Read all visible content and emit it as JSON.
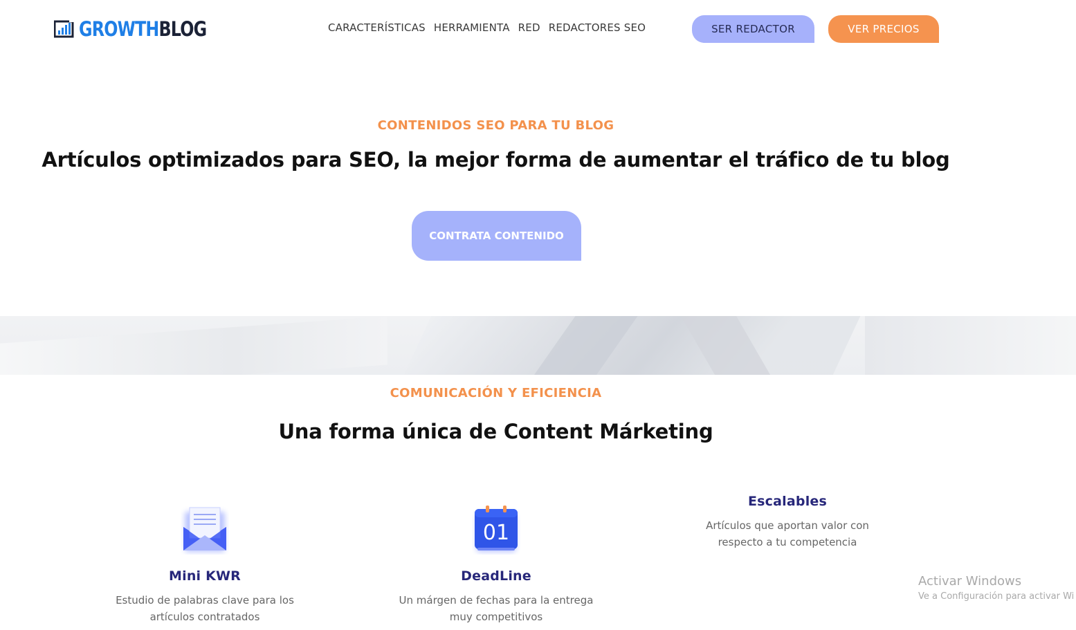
{
  "header": {
    "logo": {
      "part1": "GROWTH",
      "part2": "BLOG"
    },
    "nav": [
      {
        "label": "CARACTERÍSTICAS"
      },
      {
        "label": "HERRAMIENTA"
      },
      {
        "label": "RED"
      },
      {
        "label": "REDACTORES SEO"
      }
    ],
    "btn_redactor": "SER REDACTOR",
    "btn_precios": "VER PRECIOS"
  },
  "hero": {
    "eyebrow": "CONTENIDOS SEO PARA TU BLOG",
    "title": "Artículos optimizados para SEO, la mejor forma de aumentar el tráfico de tu blog",
    "cta": "CONTRATA CONTENIDO"
  },
  "section": {
    "eyebrow": "COMUNICACIÓN Y EFICIENCIA",
    "title": "Una forma única de Content Márketing",
    "features": [
      {
        "icon": "envelope-icon",
        "title": "Mini KWR",
        "desc": "Estudio de palabras clave para los artículos contratados"
      },
      {
        "icon": "calendar-icon",
        "icon_text": "01",
        "title": "DeadLine",
        "desc": "Un márgen de fechas para la entrega muy competitivos"
      },
      {
        "title": "Escalables",
        "desc": "Artículos que aportan valor con respecto a tu competencia"
      }
    ]
  },
  "watermark": {
    "line1": "Activar Windows",
    "line2": "Ve a Configuración para activar Wi"
  },
  "colors": {
    "accent_orange": "#f3914c",
    "accent_lavender": "#a6b1fb",
    "feature_title": "#27277a",
    "logo_blue": "#1f7fe6"
  }
}
